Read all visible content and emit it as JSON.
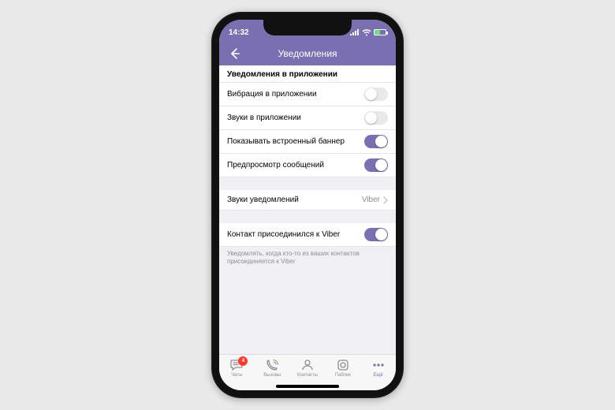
{
  "statusbar": {
    "time": "14:32"
  },
  "navbar": {
    "title": "Уведомления"
  },
  "section": {
    "header": "Уведомления в приложении"
  },
  "rows": {
    "vibration": {
      "label": "Вибрация в приложении",
      "on": false
    },
    "sounds": {
      "label": "Звуки в приложении",
      "on": false
    },
    "banner": {
      "label": "Показывать встроенный баннер",
      "on": true
    },
    "preview": {
      "label": "Предпросмотр сообщений",
      "on": true
    },
    "sound_select": {
      "label": "Звуки уведомлений",
      "value": "Viber"
    },
    "contact_joined": {
      "label": "Контакт присоединился к Viber",
      "on": true
    }
  },
  "footer_note": "Уведомлять, когда кто-то из ваших контактов присоединяется к Viber",
  "tabs": {
    "chats": {
      "label": "Чаты",
      "badge": "4"
    },
    "calls": {
      "label": "Вызовы"
    },
    "contacts": {
      "label": "Контакты"
    },
    "public": {
      "label": "Паблик"
    },
    "more": {
      "label": "Ещё"
    }
  },
  "colors": {
    "accent": "#7a6fb0"
  }
}
